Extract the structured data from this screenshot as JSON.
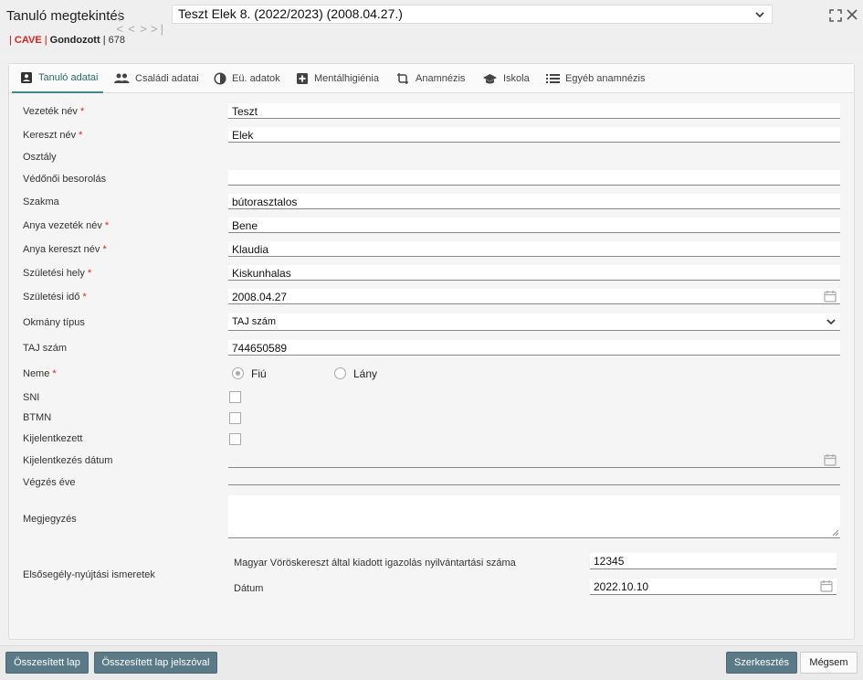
{
  "header": {
    "title": "Tanuló megtekintés",
    "nav": [
      "|<",
      "<",
      ">",
      ">|"
    ],
    "student_select": "Teszt Elek 8. (2022/2023) (2008.04.27.)",
    "status_cave": "CAVE",
    "status_gondozott": "Gondozott",
    "status_number": "678",
    "separator": "|"
  },
  "tabs": [
    {
      "label": "Tanuló adatai",
      "icon": "person-card-icon"
    },
    {
      "label": "Családi adatai",
      "icon": "people-icon"
    },
    {
      "label": "Eü. adatok",
      "icon": "contrast-icon"
    },
    {
      "label": "Mentálhigiénia",
      "icon": "plus-box-icon"
    },
    {
      "label": "Anamnézis",
      "icon": "rotate-icon"
    },
    {
      "label": "Iskola",
      "icon": "school-icon"
    },
    {
      "label": "Egyéb anamnézis",
      "icon": "list-icon"
    }
  ],
  "form": {
    "vezeteknev": {
      "label": "Vezeték név",
      "value": "Teszt"
    },
    "keresztnev": {
      "label": "Kereszt név",
      "value": "Elek"
    },
    "osztaly": {
      "label": "Osztály",
      "value": ""
    },
    "vedonoi": {
      "label": "Védőnői besorolás",
      "value": ""
    },
    "szakma": {
      "label": "Szakma",
      "value": "bútorasztalos"
    },
    "anya_vezeteknev": {
      "label": "Anya vezeték név",
      "value": "Bene"
    },
    "anya_keresztnev": {
      "label": "Anya kereszt név",
      "value": "Klaudia"
    },
    "szul_hely": {
      "label": "Születési hely",
      "value": "Kiskunhalas"
    },
    "szul_ido": {
      "label": "Születési idő",
      "value": "2008.04.27"
    },
    "okmany": {
      "label": "Okmány típus",
      "value": "TAJ szám"
    },
    "taj": {
      "label": "TAJ szám",
      "value": "744650589"
    },
    "neme": {
      "label": "Neme",
      "opt1": "Fiú",
      "opt2": "Lány",
      "selected": "Fiú"
    },
    "sni": {
      "label": "SNI",
      "checked": false
    },
    "btmn": {
      "label": "BTMN",
      "checked": false
    },
    "kijelentkezett": {
      "label": "Kijelentkezett",
      "checked": false
    },
    "kijel_datum": {
      "label": "Kijelentkezés dátum",
      "value": ""
    },
    "vegzes_eve": {
      "label": "Végzés éve",
      "value": ""
    },
    "megjegyzes": {
      "label": "Megjegyzés",
      "value": ""
    },
    "elsosegely": {
      "label": "Elsősegély-nyújtási ismeretek",
      "igazolas_label": "Magyar Vöröskereszt által kiadott igazolás nyilvántartási száma",
      "igazolas_value": "12345",
      "datum_label": "Dátum",
      "datum_value": "2022.10.10"
    },
    "required_mark": "*"
  },
  "footer": {
    "btn1": "Összesített lap",
    "btn2": "Összesített lap jelszóval",
    "edit": "Szerkesztés",
    "cancel": "Mégsem"
  }
}
